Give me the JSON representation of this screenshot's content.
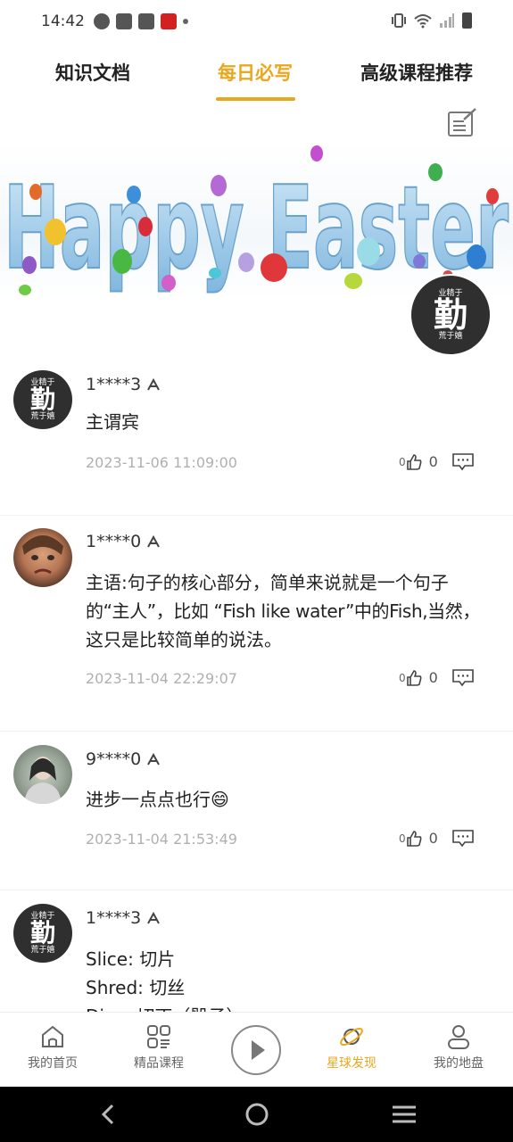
{
  "status_bar": {
    "time": "14:42",
    "left_icons": [
      "check-circle-icon",
      "mail-icon",
      "mail-icon",
      "red-app-icon",
      "dot-icon"
    ],
    "right_icons": [
      "vibrate-icon",
      "wifi-icon",
      "signal-icon",
      "battery-icon"
    ]
  },
  "tabs": [
    {
      "label": "知识文档",
      "active": false
    },
    {
      "label": "每日必写",
      "active": true
    },
    {
      "label": "高级课程推荐",
      "active": false
    }
  ],
  "accent_color": "#e8a81e",
  "banner": {
    "text": "Happy Easter",
    "logo": {
      "top": "业精于",
      "main": "勤",
      "bottom": "荒于嬉"
    }
  },
  "posts": [
    {
      "username": "1****3",
      "avatar": "logo",
      "content": [
        "主谓宾"
      ],
      "time": "2023-11-06 11:09:00",
      "likes_prefix": "0",
      "likes": "0"
    },
    {
      "username": "1****0",
      "avatar": "man-photo",
      "content": [
        "主语:句子的核心部分，简单来说就是一个句子",
        "的“主人”，比如 “Fish like water”中的Fish,当然，",
        "这只是比较简单的说法。"
      ],
      "time": "2023-11-04 22:29:07",
      "likes_prefix": "0",
      "likes": "0"
    },
    {
      "username": "9****0",
      "avatar": "woman-photo",
      "content": [
        "进步一点点也行😄"
      ],
      "time": "2023-11-04 21:53:49",
      "likes_prefix": "0",
      "likes": "0"
    },
    {
      "username": "1****3",
      "avatar": "logo",
      "content": [
        "Slice: 切片",
        "Shred: 切丝",
        "Dice: 切丁（骰子）"
      ],
      "time": "",
      "likes_prefix": "",
      "likes": ""
    }
  ],
  "bottom_nav": [
    {
      "label": "我的首页",
      "icon": "home-icon",
      "active": false
    },
    {
      "label": "精品课程",
      "icon": "grid-icon",
      "active": false
    },
    {
      "label": "",
      "icon": "play-icon",
      "active": false
    },
    {
      "label": "星球发现",
      "icon": "planet-icon",
      "active": true
    },
    {
      "label": "我的地盘",
      "icon": "user-icon",
      "active": false
    }
  ]
}
